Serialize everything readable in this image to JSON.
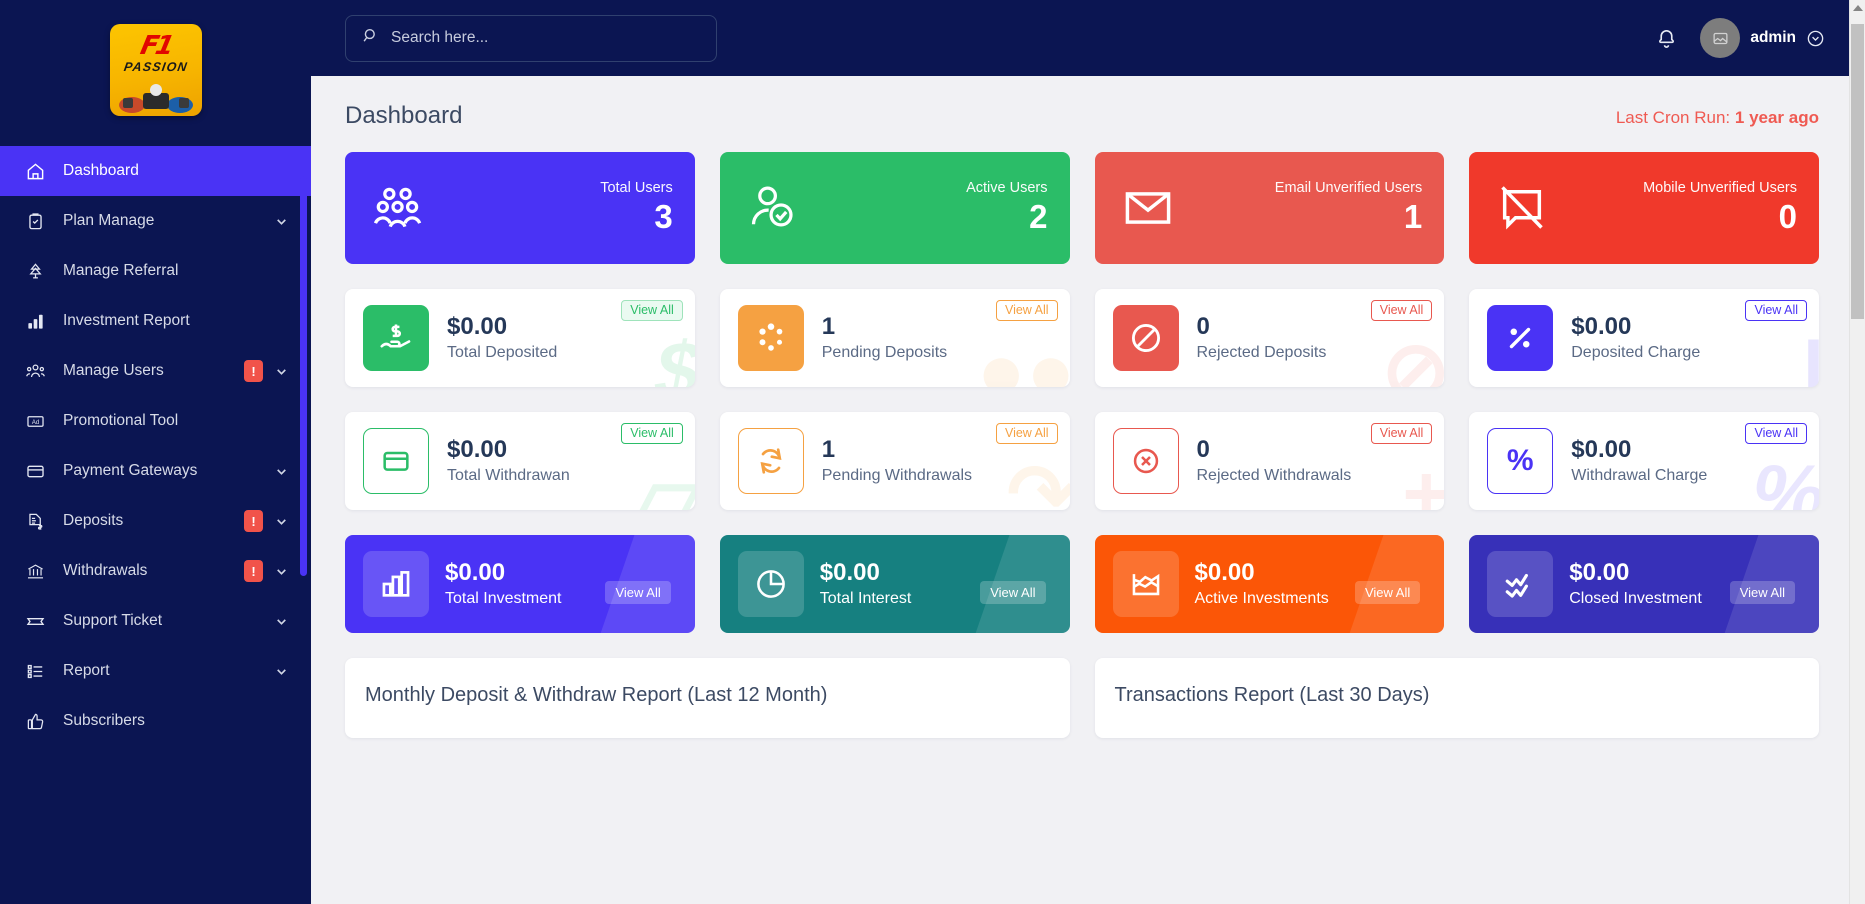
{
  "brand": {
    "logo_line1": "F1",
    "logo_line2": "PASSION"
  },
  "sidebar": {
    "items": [
      {
        "label": "Dashboard",
        "icon": "home-icon",
        "badge": null,
        "caret": false,
        "active": true
      },
      {
        "label": "Plan Manage",
        "icon": "clipboard-check-icon",
        "badge": null,
        "caret": true,
        "active": false
      },
      {
        "label": "Manage Referral",
        "icon": "referral-tree-icon",
        "badge": null,
        "caret": false,
        "active": false
      },
      {
        "label": "Investment Report",
        "icon": "bar-chart-icon",
        "badge": null,
        "caret": false,
        "active": false
      },
      {
        "label": "Manage Users",
        "icon": "users-group-icon",
        "badge": "!",
        "caret": true,
        "active": false
      },
      {
        "label": "Promotional Tool",
        "icon": "ad-banner-icon",
        "badge": null,
        "caret": false,
        "active": false
      },
      {
        "label": "Payment Gateways",
        "icon": "credit-card-icon",
        "badge": null,
        "caret": true,
        "active": false
      },
      {
        "label": "Deposits",
        "icon": "document-dollar-icon",
        "badge": "!",
        "caret": true,
        "active": false
      },
      {
        "label": "Withdrawals",
        "icon": "bank-icon",
        "badge": "!",
        "caret": true,
        "active": false
      },
      {
        "label": "Support Ticket",
        "icon": "ticket-icon",
        "badge": null,
        "caret": true,
        "active": false
      },
      {
        "label": "Report",
        "icon": "list-report-icon",
        "badge": null,
        "caret": true,
        "active": false
      },
      {
        "label": "Subscribers",
        "icon": "thumbs-up-icon",
        "badge": null,
        "caret": false,
        "active": false
      }
    ]
  },
  "topbar": {
    "search_placeholder": "Search here...",
    "search_value": "",
    "username": "admin"
  },
  "page": {
    "title": "Dashboard",
    "cron_label": "Last Cron Run:",
    "cron_value": "1 year ago"
  },
  "stat_cards": [
    {
      "label": "Total Users",
      "value": "3",
      "bg": "#4a33f5",
      "icon": "users-triple-icon"
    },
    {
      "label": "Active Users",
      "value": "2",
      "bg": "#2bbd68",
      "icon": "user-check-icon"
    },
    {
      "label": "Email Unverified Users",
      "value": "1",
      "bg": "#e8584f",
      "icon": "envelope-icon"
    },
    {
      "label": "Mobile Unverified Users",
      "value": "0",
      "bg": "#f0392b",
      "icon": "mobile-slash-icon"
    }
  ],
  "deposit_cards": [
    {
      "value": "$0.00",
      "label": "Total Deposited",
      "view_all": "View All",
      "color": "#2bbd68",
      "filled": true,
      "icon": "hand-dollar-icon",
      "watermark": "$"
    },
    {
      "value": "1",
      "label": "Pending Deposits",
      "view_all": "View All",
      "color": "#f5a142",
      "filled": true,
      "icon": "spinner-dots-icon",
      "watermark": ""
    },
    {
      "value": "0",
      "label": "Rejected Deposits",
      "view_all": "View All",
      "color": "#e8584f",
      "filled": true,
      "icon": "ban-icon",
      "watermark": ""
    },
    {
      "value": "$0.00",
      "label": "Deposited Charge",
      "view_all": "View All",
      "color": "#4a33f5",
      "filled": true,
      "icon": "percent-icon",
      "watermark": ""
    }
  ],
  "withdraw_cards": [
    {
      "value": "$0.00",
      "label": "Total Withdrawan",
      "view_all": "View All",
      "color": "#2bbd68",
      "filled": false,
      "icon": "card-outline-icon",
      "watermark": ""
    },
    {
      "value": "1",
      "label": "Pending Withdrawals",
      "view_all": "View All",
      "color": "#f5a142",
      "filled": false,
      "icon": "refresh-cycle-icon",
      "watermark": ""
    },
    {
      "value": "0",
      "label": "Rejected Withdrawals",
      "view_all": "View All",
      "color": "#e8584f",
      "filled": false,
      "icon": "circle-x-icon",
      "watermark": ""
    },
    {
      "value": "$0.00",
      "label": "Withdrawal Charge",
      "view_all": "View All",
      "color": "#4a33f5",
      "filled": false,
      "icon": "percent-outline-icon",
      "watermark": ""
    }
  ],
  "investment_cards": [
    {
      "value": "$0.00",
      "label": "Total Investment",
      "view_all": "View All",
      "bg": "#4a33f5",
      "icon": "bar-chart-box-icon"
    },
    {
      "value": "$0.00",
      "label": "Total Interest",
      "view_all": "View All",
      "bg": "#168080",
      "icon": "pie-chart-icon"
    },
    {
      "value": "$0.00",
      "label": "Active Investments",
      "view_all": "View All",
      "bg": "#fb5607",
      "icon": "area-chart-icon"
    },
    {
      "value": "$0.00",
      "label": "Closed Investment",
      "view_all": "View All",
      "bg": "#3730b8",
      "icon": "zigzag-line-icon"
    }
  ],
  "reports": [
    {
      "title": "Monthly Deposit & Withdraw Report (Last 12 Month)"
    },
    {
      "title": "Transactions Report (Last 30 Days)"
    }
  ]
}
